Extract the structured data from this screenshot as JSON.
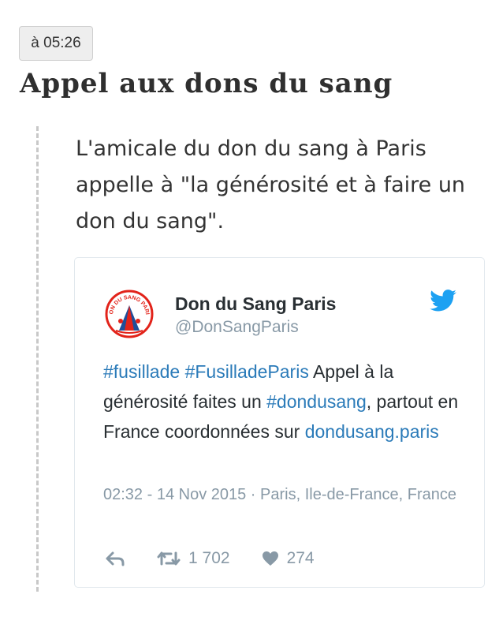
{
  "post": {
    "time": "à 05:26",
    "title": "Appel aux dons du sang",
    "body": "L'amicale du don du sang à Paris appelle à \"la générosité et à faire un don du sang\"."
  },
  "tweet": {
    "user_name": "Don du Sang Paris",
    "handle": "@DonSangParis",
    "avatar_text": "DON DU SANG PARIS",
    "text_segments": [
      {
        "text": "#fusillade",
        "link": true
      },
      {
        "text": " ",
        "link": false
      },
      {
        "text": "#FusilladeParis",
        "link": true
      },
      {
        "text": " Appel à la générosité faites un ",
        "link": false
      },
      {
        "text": "#dondusang",
        "link": true
      },
      {
        "text": ", partout en France coordonnées sur ",
        "link": false
      },
      {
        "text": "dondusang.paris",
        "link": true
      }
    ],
    "meta": "02:32 - 14 Nov 2015 · Paris, Ile-de-France, France",
    "retweet_count": "1 702",
    "like_count": "274",
    "colors": {
      "link": "#2b7bb9",
      "muted": "#8899a6",
      "twitter_blue": "#1da1f2",
      "avatar_red": "#e2231a"
    },
    "icons": [
      "twitter-bird-icon",
      "reply-icon",
      "retweet-icon",
      "heart-icon"
    ]
  }
}
